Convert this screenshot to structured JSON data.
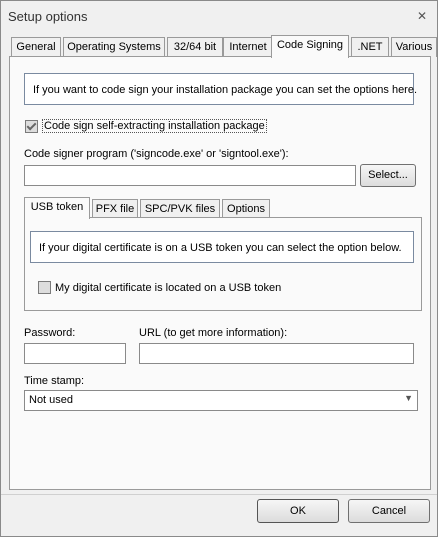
{
  "window": {
    "title": "Setup options"
  },
  "tabs": [
    {
      "label": "General"
    },
    {
      "label": "Operating Systems"
    },
    {
      "label": "32/64 bit"
    },
    {
      "label": "Internet"
    },
    {
      "label": "Code Signing"
    },
    {
      "label": ".NET"
    },
    {
      "label": "Various"
    }
  ],
  "code_signing": {
    "info_text": "If you want to code sign your installation package you can set the options here.",
    "sign_checkbox": {
      "label": "Code sign self-extracting installation package",
      "checked": true
    },
    "signer_program_label": "Code signer program ('signcode.exe' or 'signtool.exe'):",
    "signer_program_value": "",
    "select_button": "Select...",
    "subtabs": [
      {
        "label": "USB token"
      },
      {
        "label": "PFX file"
      },
      {
        "label": "SPC/PVK files"
      },
      {
        "label": "Options"
      }
    ],
    "usb_info_text": "If your digital certificate is on a USB token you can select the option below.",
    "usb_checkbox": {
      "label": "My digital certificate is located on a USB token",
      "checked": false
    },
    "password_label": "Password:",
    "password_value": "",
    "url_label": "URL (to get more information):",
    "url_value": "",
    "timestamp_label": "Time stamp:",
    "timestamp_value": "Not used"
  },
  "footer": {
    "ok": "OK",
    "cancel": "Cancel"
  }
}
